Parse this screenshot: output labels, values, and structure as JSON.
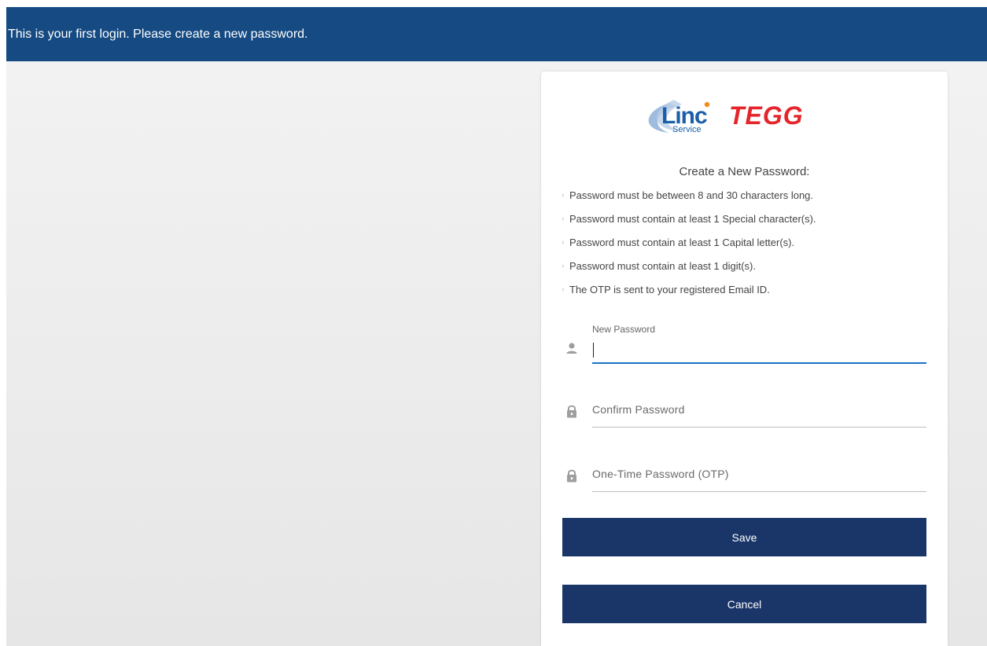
{
  "banner": {
    "message": "This is your first login. Please create a new password."
  },
  "logo": {
    "brand_primary": "Linc",
    "brand_sub": "Service",
    "brand_secondary": "TEGG",
    "colors": {
      "linc_blue": "#1b5fa8",
      "tegg_red": "#e4252b"
    }
  },
  "form": {
    "title": "Create a New Password:",
    "rules": [
      "Password must be between 8 and 30 characters long.",
      "Password must contain at least 1 Special character(s).",
      "Password must contain at least 1 Capital letter(s).",
      "Password must contain at least 1 digit(s).",
      "The OTP is sent to your registered Email ID."
    ],
    "fields": {
      "new_password": {
        "label": "New Password",
        "value": "",
        "icon": "user-icon"
      },
      "confirm_password": {
        "placeholder": "Confirm Password",
        "value": "",
        "icon": "lock-icon"
      },
      "otp": {
        "placeholder": "One-Time Password (OTP)",
        "value": "",
        "icon": "lock-icon"
      }
    },
    "buttons": {
      "save_label": "Save",
      "cancel_label": "Cancel"
    }
  },
  "colors": {
    "banner_bg": "#154a82",
    "button_bg": "#1a3668",
    "active_underline": "#1a73c9"
  }
}
